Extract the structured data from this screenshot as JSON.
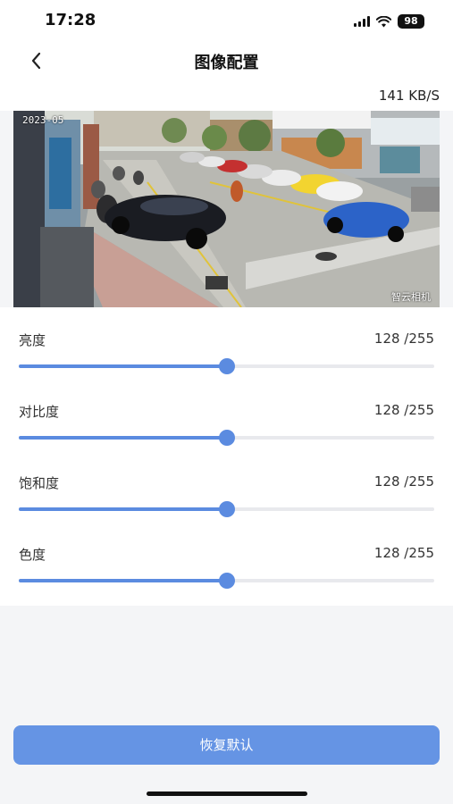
{
  "status_bar": {
    "time": "17:28",
    "signal_icon": "signal-bars-icon",
    "wifi_icon": "wifi-icon",
    "battery_level": "98"
  },
  "nav": {
    "back_icon": "chevron-left-icon",
    "title": "图像配置"
  },
  "stream": {
    "bitrate": "141 KB/S",
    "camera_timestamp": "2023-05",
    "camera_watermark": "智云相机"
  },
  "settings": [
    {
      "label": "亮度",
      "value_text": "128 /255",
      "value": 128,
      "max": 255
    },
    {
      "label": "对比度",
      "value_text": "128 /255",
      "value": 128,
      "max": 255
    },
    {
      "label": "饱和度",
      "value_text": "128 /255",
      "value": 128,
      "max": 255
    },
    {
      "label": "色度",
      "value_text": "128 /255",
      "value": 128,
      "max": 255
    }
  ],
  "reset_button": {
    "label": "恢复默认"
  },
  "colors": {
    "accent": "#5b8be0",
    "button": "#6594e4",
    "track": "#e8e9ed",
    "background": "#f4f5f7"
  }
}
